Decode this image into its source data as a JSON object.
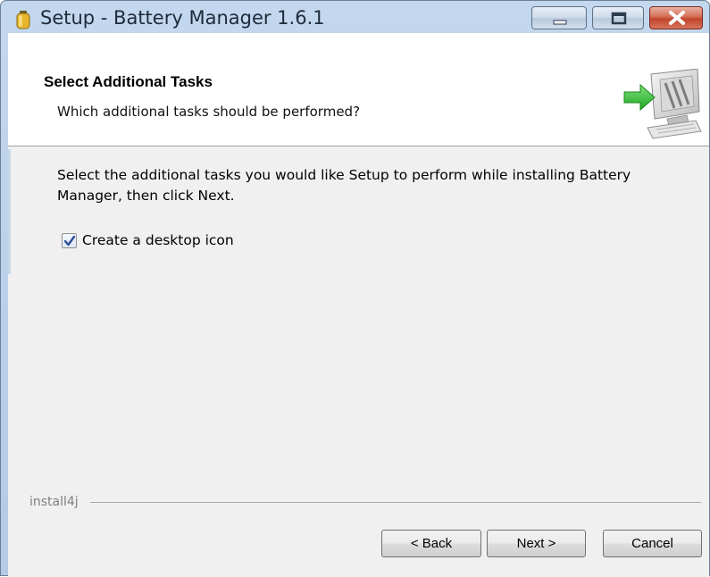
{
  "window": {
    "title": "Setup - Battery Manager 1.6.1",
    "icon": "battery-icon",
    "controls": [
      "minimize-icon",
      "maximize-icon",
      "close-icon"
    ]
  },
  "header": {
    "title": "Select Additional Tasks",
    "subtitle": "Which additional tasks should be performed?",
    "graphic": "computer-install-arrow-icon"
  },
  "body": {
    "instructions": "Select the additional tasks you would like Setup to perform while installing Battery Manager, then click Next.",
    "tasks": [
      {
        "label": "Create a desktop icon",
        "checked": true
      }
    ]
  },
  "footer": {
    "brand": "install4j",
    "back_label": "< Back",
    "next_label": "Next >",
    "cancel_label": "Cancel"
  },
  "colors": {
    "titlebar": "#b3cbe6",
    "close_button": "#c2452c",
    "client_background": "#f0f0f0",
    "header_background": "#ffffff",
    "accent_green": "#3cc43c"
  }
}
